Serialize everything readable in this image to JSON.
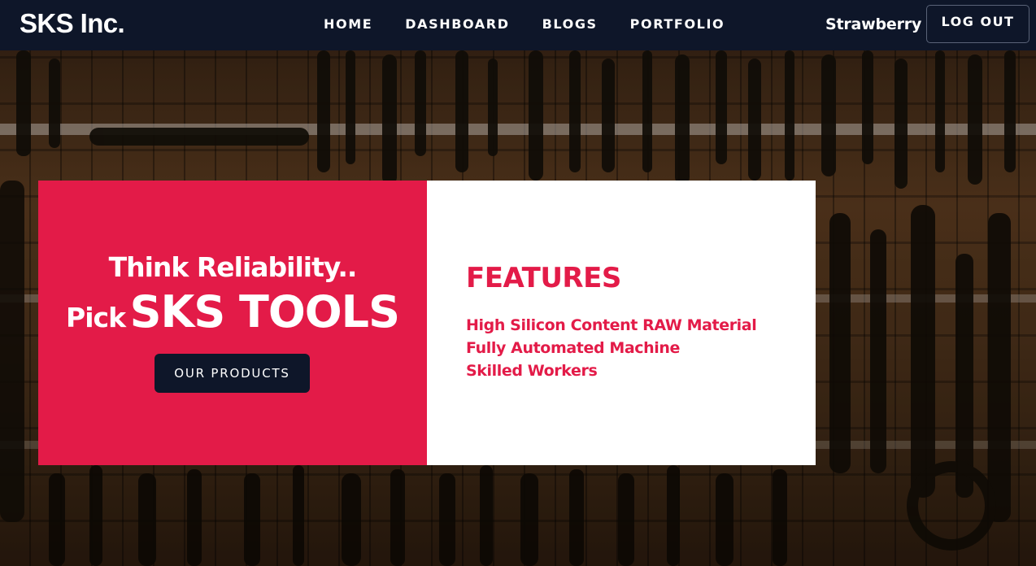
{
  "navbar": {
    "brand": "SKS Inc.",
    "links": [
      {
        "label": "HOME"
      },
      {
        "label": "DASHBOARD"
      },
      {
        "label": "BLOGS"
      },
      {
        "label": "PORTFOLIO"
      }
    ],
    "username": "Strawberry",
    "logout_label": "LOG OUT"
  },
  "hero": {
    "tagline_line1": "Think Reliability..",
    "tagline_pick": "Pick",
    "tagline_brand": "SKS TOOLS",
    "cta_label": "OUR PRODUCTS"
  },
  "features": {
    "title": "FEATURES",
    "items": [
      "High Silicon Content RAW Material",
      "Fully Automated Machine",
      "Skilled Workers"
    ]
  },
  "colors": {
    "navbar_bg": "#0e1629",
    "accent_red": "#e31b48",
    "card_white": "#ffffff",
    "button_dark": "#0e1629"
  },
  "background_image": "tools-wall-photo"
}
